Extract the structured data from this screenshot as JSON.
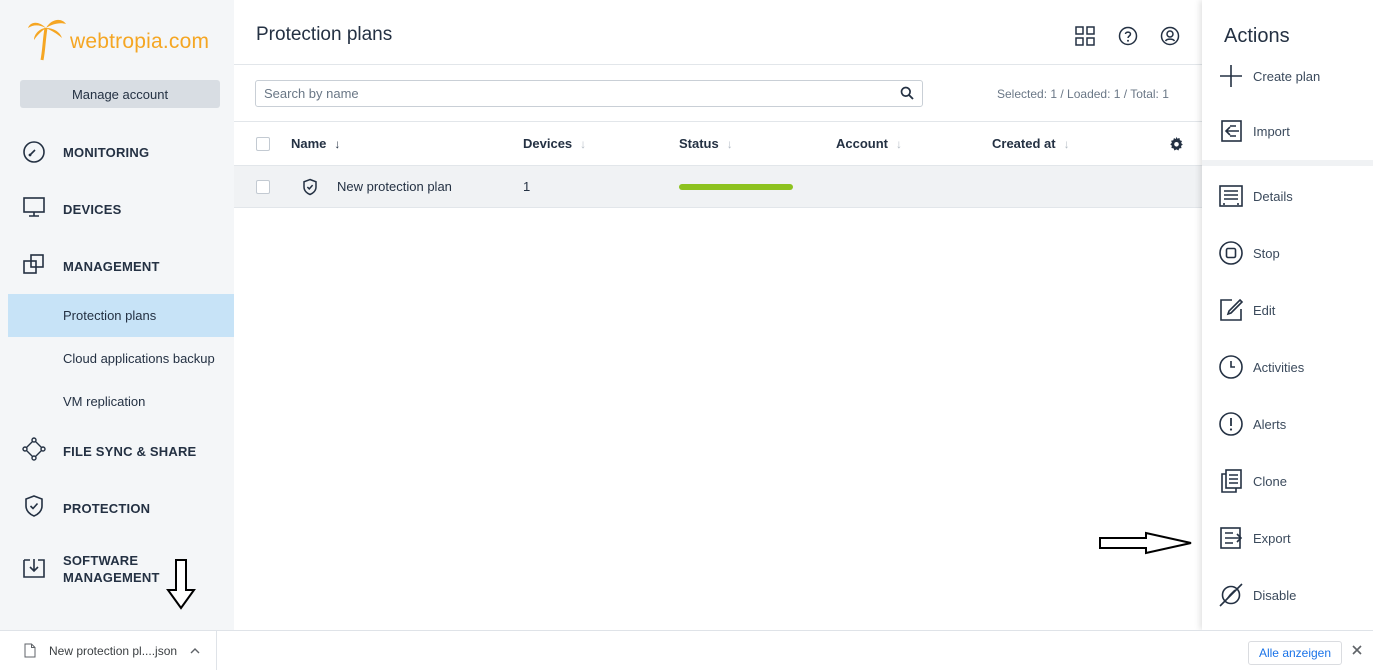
{
  "brand": {
    "logo_text": "webtropia.com",
    "accent": "#f5a623"
  },
  "sidebar": {
    "manage_account": "Manage account",
    "sections": [
      {
        "label": "MONITORING",
        "icon": "gauge-icon"
      },
      {
        "label": "DEVICES",
        "icon": "monitor-icon"
      },
      {
        "label": "MANAGEMENT",
        "icon": "management-icon"
      },
      {
        "label": "FILE SYNC & SHARE",
        "icon": "sync-share-icon"
      },
      {
        "label": "PROTECTION",
        "icon": "shield-icon"
      },
      {
        "label": "SOFTWARE",
        "label2": "MANAGEMENT",
        "icon": "software-icon"
      }
    ],
    "management_items": [
      {
        "label": "Protection plans",
        "active": true
      },
      {
        "label": "Cloud applications backup",
        "active": false
      },
      {
        "label": "VM replication",
        "active": false
      }
    ]
  },
  "header": {
    "title": "Protection plans",
    "icons": [
      "grid-icon",
      "help-icon",
      "account-icon"
    ]
  },
  "toolbar": {
    "search_placeholder": "Search by name",
    "counter": "Selected: 1 / Loaded: 1 / Total: 1"
  },
  "table": {
    "columns": [
      "Name",
      "Devices",
      "Status",
      "Account",
      "Created at"
    ],
    "rows": [
      {
        "name": "New protection plan",
        "devices": "1",
        "status_progress": 1.0,
        "status_color": "#8dc21f",
        "account": "",
        "created_at": ""
      }
    ]
  },
  "actions": {
    "title": "Actions",
    "items": [
      {
        "label": "Create plan",
        "icon": "plus-icon"
      },
      {
        "label": "Import",
        "icon": "import-icon"
      },
      {
        "label": "Details",
        "icon": "details-icon"
      },
      {
        "label": "Stop",
        "icon": "stop-icon"
      },
      {
        "label": "Edit",
        "icon": "edit-icon"
      },
      {
        "label": "Activities",
        "icon": "clock-icon"
      },
      {
        "label": "Alerts",
        "icon": "alert-icon"
      },
      {
        "label": "Clone",
        "icon": "clone-icon"
      },
      {
        "label": "Export",
        "icon": "export-icon"
      },
      {
        "label": "Disable",
        "icon": "disable-icon"
      }
    ]
  },
  "download_bar": {
    "file_name": "New protection pl....json",
    "show_all": "Alle anzeigen"
  }
}
